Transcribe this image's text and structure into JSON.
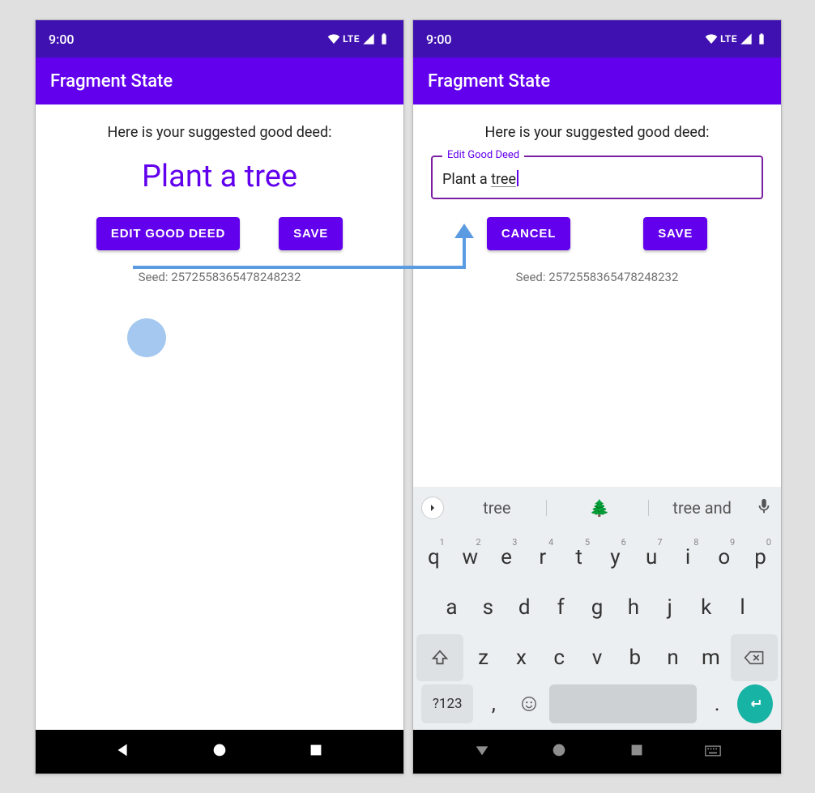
{
  "status": {
    "time": "9:00",
    "network": "LTE"
  },
  "app": {
    "title": "Fragment State"
  },
  "left": {
    "subhead": "Here is your suggested good deed:",
    "deed": "Plant a tree",
    "buttons": {
      "edit": "EDIT GOOD DEED",
      "save": "SAVE"
    },
    "seed": "Seed: 2572558365478248232"
  },
  "right": {
    "subhead": "Here is your suggested good deed:",
    "field": {
      "legend": "Edit Good Deed",
      "prefix": "Plant a ",
      "underlined": "tree"
    },
    "buttons": {
      "cancel": "CANCEL",
      "save": "SAVE"
    },
    "seed": "Seed: 2572558365478248232"
  },
  "keyboard": {
    "suggestions": [
      "tree",
      "🌲",
      "tree and"
    ],
    "row1": [
      "q",
      "w",
      "e",
      "r",
      "t",
      "y",
      "u",
      "i",
      "o",
      "p"
    ],
    "row1_sup": [
      "1",
      "2",
      "3",
      "4",
      "5",
      "6",
      "7",
      "8",
      "9",
      "0"
    ],
    "row2": [
      "a",
      "s",
      "d",
      "f",
      "g",
      "h",
      "j",
      "k",
      "l"
    ],
    "row3": [
      "z",
      "x",
      "c",
      "v",
      "b",
      "n",
      "m"
    ],
    "bottom": {
      "sym": "?123",
      "comma": ",",
      "period": "."
    }
  }
}
